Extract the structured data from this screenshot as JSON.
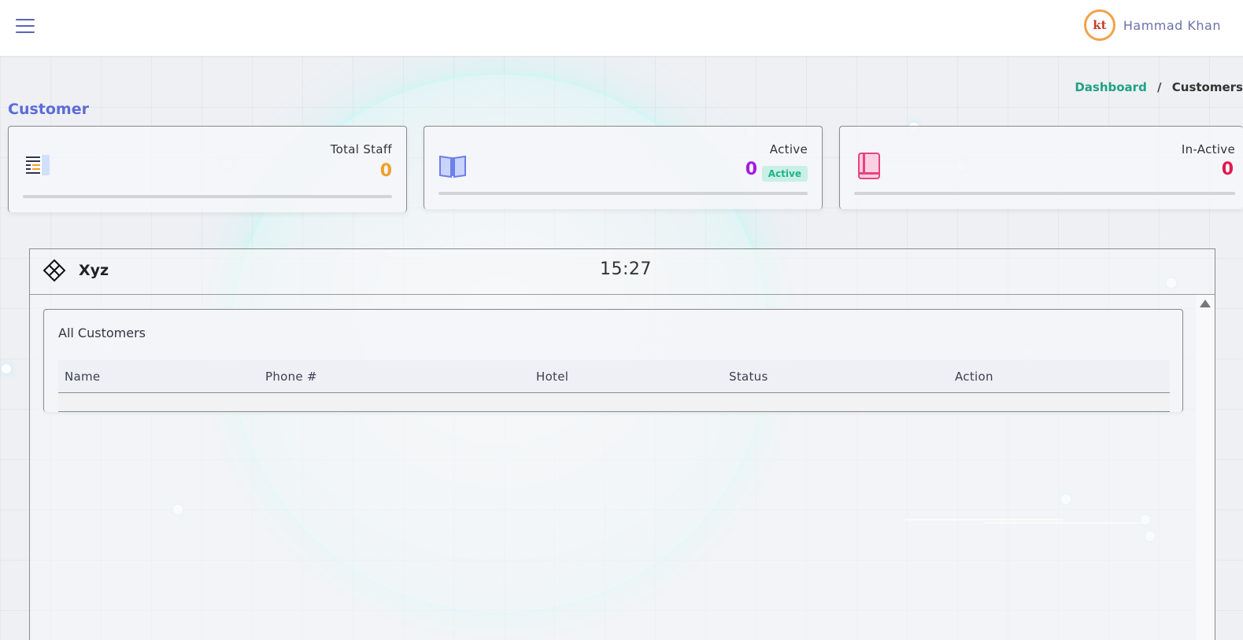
{
  "header": {
    "user_name": "Hammad Khan",
    "avatar_initials": "kt"
  },
  "page": {
    "title": "Customer",
    "breadcrumb": {
      "link": "Dashboard",
      "separator": "/",
      "current": "Customers"
    }
  },
  "stats": [
    {
      "label": "Total Staff",
      "value": "0",
      "color": "#f0a02a",
      "icon": "report-icon"
    },
    {
      "label": "Active",
      "value": "0",
      "badge": "Active",
      "color": "#a31be0",
      "icon": "open-book-icon"
    },
    {
      "label": "In-Active",
      "value": "0",
      "color": "#e0194f",
      "icon": "book-icon"
    }
  ],
  "panel": {
    "title": "Xyz",
    "time": "15:27",
    "table": {
      "title": "All Customers",
      "columns": [
        "Name",
        "Phone #",
        "Hotel",
        "Status",
        "Action"
      ],
      "rows": []
    }
  },
  "colors": {
    "accent": "#5d6bd8",
    "breadcrumb_link": "#1fa184",
    "active_badge_bg": "#c9f0e4",
    "active_badge_text": "#22b28a"
  }
}
